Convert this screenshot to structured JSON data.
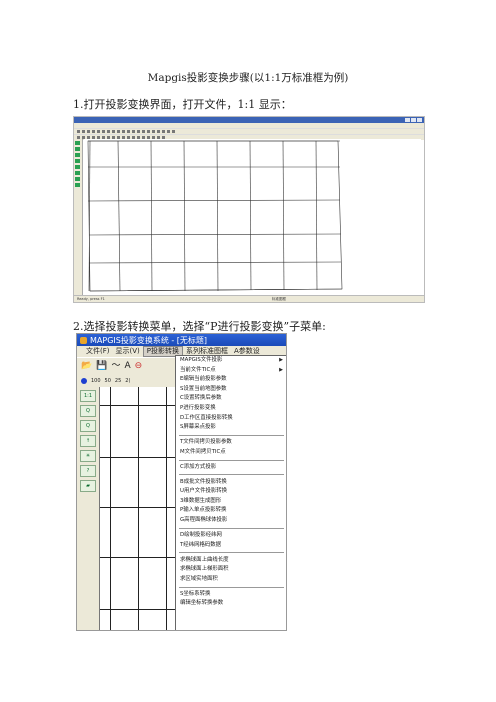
{
  "doc": {
    "title": "Mapgis投影变换步骤(以1:1万标准框为例)",
    "step1": "1.打开投影变换界面，打开文件，1:1 显示：",
    "step2": "2.选择投影转换菜单，选择“P进行投影变换”子菜单:"
  },
  "shot1": {
    "status_left": "Ready, press F1",
    "status_mid": "标准图框"
  },
  "shot2": {
    "app_title": "MAPGIS投影变换系统 - [无标题]",
    "menu": [
      "文件(F)",
      "显示(V)",
      "P投影转换",
      "系列标准图框",
      "A参数设"
    ],
    "active_menu": "P投影转换",
    "scale_values": [
      "100",
      "50",
      "25",
      "2("
    ],
    "left_buttons": [
      "1:1",
      "Q",
      "Q",
      "↑",
      "✳",
      "?",
      "▰"
    ],
    "dropdown": [
      {
        "label": "MAPGIS文件投影",
        "submenu": true
      },
      {
        "label": "当前文件TIC点",
        "submenu": true
      },
      {
        "label": "E编辑当前投影参数"
      },
      {
        "label": "S设置当前地图参数"
      },
      {
        "label": "C设置转换后参数"
      },
      {
        "label": "P进行投影变换"
      },
      {
        "label": "D工作区直接投影转换"
      },
      {
        "label": "S屏幕采点投影"
      },
      {
        "sep": true
      },
      {
        "label": "T文件间拷贝投影参数"
      },
      {
        "label": "M文件间拷贝TIC点"
      },
      {
        "sep": true
      },
      {
        "label": "C添加方式投影"
      },
      {
        "sep": true
      },
      {
        "label": "B成批文件投影转换"
      },
      {
        "label": "U用户文件投影转换"
      },
      {
        "label": "3维数据生成图形"
      },
      {
        "label": "P输入单点投影转换"
      },
      {
        "label": "G高程面椭球体投影"
      },
      {
        "sep": true
      },
      {
        "label": "D绘制投影经纬网"
      },
      {
        "label": "T经纬网格码数据"
      },
      {
        "sep": true
      },
      {
        "label": "求椭球面上曲线长度"
      },
      {
        "label": "求椭球面上梯形面积"
      },
      {
        "label": "求区域实地面积"
      },
      {
        "sep": true
      },
      {
        "label": "S坐标系转换"
      },
      {
        "label": "编辑坐标转换参数"
      }
    ]
  }
}
